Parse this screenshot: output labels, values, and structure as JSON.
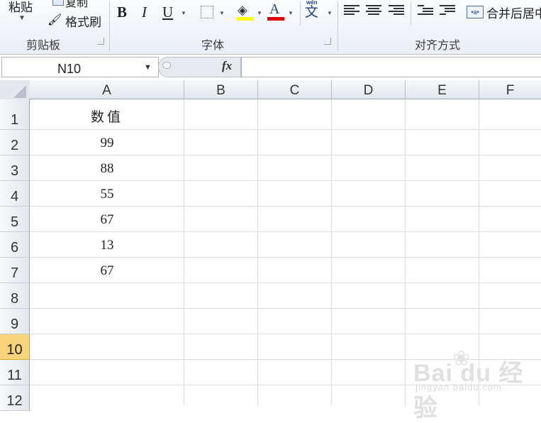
{
  "ribbon": {
    "clipboard": {
      "paste_label": "粘贴",
      "copy_label": "复制",
      "format_painter_label": "格式刷",
      "group_label": "剪贴板"
    },
    "font": {
      "bold": "B",
      "italic": "I",
      "underline": "U",
      "font_color_letter": "A",
      "phonetic_small": "wén",
      "phonetic_char": "文",
      "group_label": "字体",
      "fill_color": "#ffff00",
      "font_color": "#e00000"
    },
    "alignment": {
      "merge_label": "合并后居中",
      "merge_icon_text": "•a•",
      "group_label": "对齐方式"
    }
  },
  "formula_bar": {
    "name_box": "N10",
    "fx_label": "fx",
    "formula": ""
  },
  "grid": {
    "columns": [
      "A",
      "B",
      "C",
      "D",
      "E",
      "F"
    ],
    "rows": [
      "1",
      "2",
      "3",
      "4",
      "5",
      "6",
      "7",
      "8",
      "9",
      "10",
      "11",
      "12"
    ],
    "active_row": "10",
    "cells_A": [
      "数值",
      "99",
      "88",
      "55",
      "67",
      "13",
      "67"
    ]
  },
  "watermark": {
    "logo": "Bai du 经验",
    "url": "jingyan.baidu.com"
  }
}
